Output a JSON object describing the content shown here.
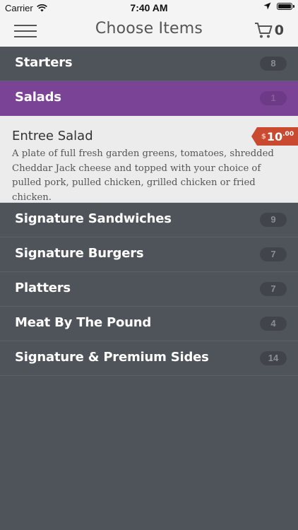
{
  "status": {
    "carrier": "Carrier",
    "time": "7:40 AM"
  },
  "nav": {
    "title": "Choose Items",
    "cart_count": "0"
  },
  "categories": [
    {
      "label": "Starters",
      "count": "8"
    },
    {
      "label": "Salads",
      "count": "1"
    },
    {
      "label": "Signature Sandwiches",
      "count": "9"
    },
    {
      "label": "Signature Burgers",
      "count": "7"
    },
    {
      "label": "Platters",
      "count": "7"
    },
    {
      "label": "Meat By The Pound",
      "count": "4"
    },
    {
      "label": "Signature & Premium Sides",
      "count": "14"
    }
  ],
  "expanded_item": {
    "name": "Entree Salad",
    "description": "A plate of full fresh garden greens, tomatoes, shredded Cheddar Jack cheese and topped with your choice of pulled pork, pulled chicken, grilled chicken or fried chicken.",
    "price_currency": "$",
    "price_dollars": "10",
    "price_cents": ".00"
  },
  "colors": {
    "background": "#4f545b",
    "active_category": "#7a4396",
    "price_tag": "#c94a30"
  }
}
